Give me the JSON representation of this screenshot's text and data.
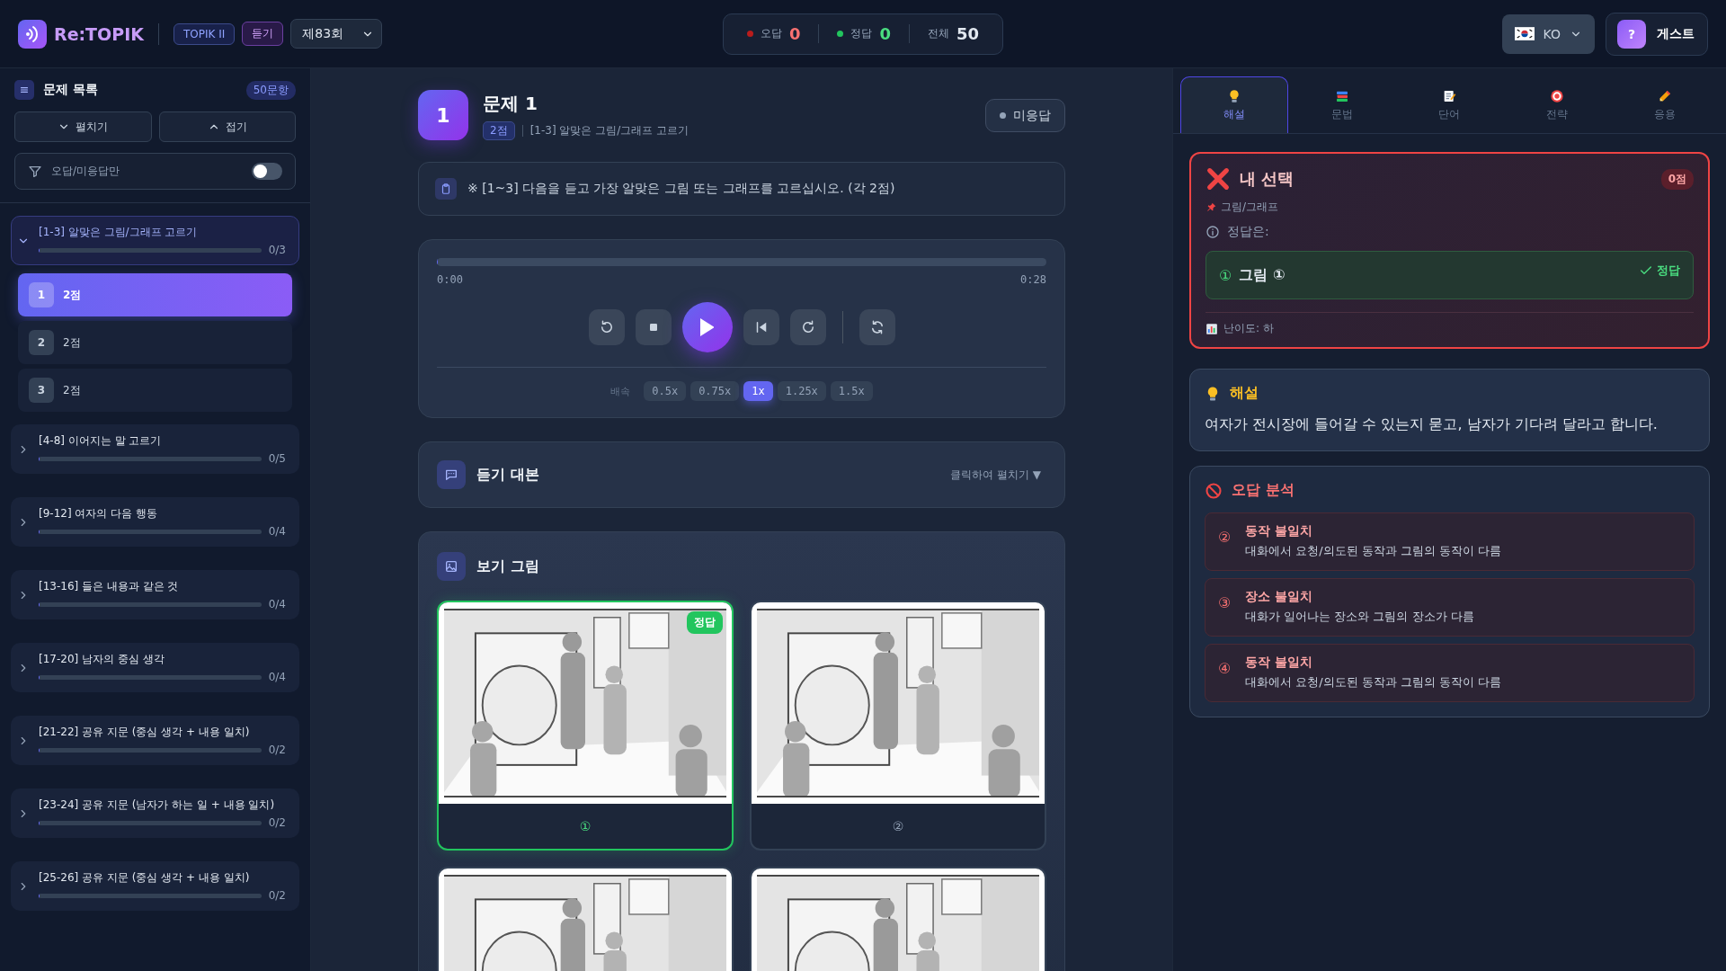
{
  "header": {
    "logo": "Re:TOPIK",
    "level_badge": "TOPIK II",
    "section_badge": "듣기",
    "round_select": "제83회",
    "stats": [
      {
        "kind": "wrong",
        "label": "오답",
        "value": "0"
      },
      {
        "kind": "correct",
        "label": "정답",
        "value": "0"
      },
      {
        "kind": "total",
        "label": "전체",
        "value": "50"
      }
    ],
    "language": "KO",
    "user": {
      "avatar": "?",
      "name": "게스트"
    }
  },
  "sidebar": {
    "title": "문제 목록",
    "count": "50문항",
    "buttons": [
      {
        "kind": "expand",
        "label": "펼치기"
      },
      {
        "kind": "collapse",
        "label": "접기"
      }
    ],
    "filter": {
      "label": "오답/미응답만",
      "on": false
    },
    "groups": [
      {
        "title": "[1-3] 알맞은 그림/그래프 고르기",
        "progress": "0/3",
        "level": 0,
        "expanded": true,
        "questions": [
          {
            "number": "1",
            "points": "2점",
            "selected": true
          },
          {
            "number": "2",
            "points": "2점",
            "selected": false
          },
          {
            "number": "3",
            "points": "2점",
            "selected": false
          }
        ]
      },
      {
        "title": "[4-8] 이어지는 말 고르기",
        "progress": "0/5",
        "level": 0,
        "expanded": false
      },
      {
        "title": "[9-12] 여자의 다음 행동",
        "progress": "0/4",
        "level": 0,
        "expanded": false
      },
      {
        "title": "[13-16] 들은 내용과 같은 것",
        "progress": "0/4",
        "level": 0,
        "expanded": false
      },
      {
        "title": "[17-20] 남자의 중심 생각",
        "progress": "0/4",
        "level": 0,
        "expanded": false
      },
      {
        "title": "[21-22] 공유 지문 (중심 생각 + 내용 일치)",
        "progress": "0/2",
        "level": 0,
        "expanded": false
      },
      {
        "title": "[23-24] 공유 지문 (남자가 하는 일 + 내용 일치)",
        "progress": "0/2",
        "level": 0,
        "expanded": false
      },
      {
        "title": "[25-26] 공유 지문 (중심 생각 + 내용 일치)",
        "progress": "0/2",
        "level": 0,
        "expanded": false
      }
    ]
  },
  "question": {
    "number": "1",
    "title": "문제 1",
    "points": "2점",
    "category": "[1-3] 알맞은 그림/그래프 고르기",
    "status": "미응답",
    "instruction": "※ [1~3] 다음을 듣고 가장 알맞은 그림 또는 그래프를 고르십시오. (각 2점)",
    "player": {
      "level": 0,
      "current_time": "0:00",
      "total_time": "0:28",
      "speed_label": "배속",
      "speeds": [
        {
          "label": "0.5x",
          "selected": false
        },
        {
          "label": "0.75x",
          "selected": false
        },
        {
          "label": "1x",
          "selected": true
        },
        {
          "label": "1.25x",
          "selected": false
        },
        {
          "label": "1.5x",
          "selected": false
        }
      ]
    },
    "transcript": {
      "title": "듣기 대본",
      "toggle": "클릭하여 펼치기 ▼"
    },
    "options": {
      "title": "보기 그림",
      "items": [
        {
          "kind": "picture",
          "label": "①",
          "correct": true,
          "badge": "정답"
        },
        {
          "kind": "picture",
          "label": "②",
          "correct": false
        },
        {
          "kind": "picture",
          "correct": false
        },
        {
          "kind": "picture",
          "correct": false
        }
      ]
    }
  },
  "panel": {
    "tabs": [
      {
        "label": "해설",
        "selected": true
      },
      {
        "label": "문법",
        "selected": false
      },
      {
        "label": "단어",
        "selected": false
      },
      {
        "label": "전략",
        "selected": false
      },
      {
        "label": "응용",
        "selected": false
      }
    ],
    "my_choice": {
      "title": "내 선택",
      "score": "0점",
      "tag": "그림/그래프",
      "answer_label": "정답은:",
      "answer": {
        "number": "①",
        "text": "그림 ①",
        "status": "정답"
      },
      "difficulty": "난이도: 하"
    },
    "explanation": {
      "title": "해설",
      "text": "여자가 전시장에 들어갈 수 있는지 묻고, 남자가 기다려 달라고 합니다."
    },
    "analysis": {
      "title": "오답 분석",
      "items": [
        {
          "number": "②",
          "title": "동작 불일치",
          "text": "대화에서 요청/의도된 동작과 그림의 동작이 다름"
        },
        {
          "number": "③",
          "title": "장소 불일치",
          "text": "대화가 일어나는 장소와 그림의 장소가 다름"
        },
        {
          "number": "④",
          "title": "동작 불일치",
          "text": "대화에서 요청/의도된 동작과 그림의 동작이 다름"
        }
      ]
    }
  }
}
